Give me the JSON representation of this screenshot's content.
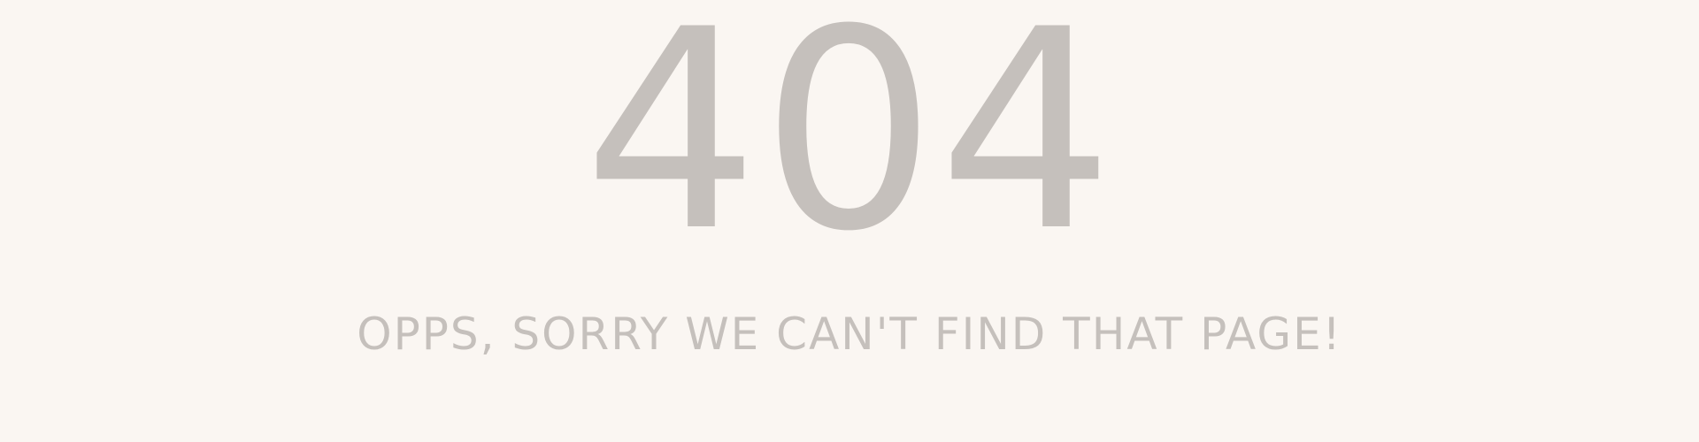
{
  "error": {
    "code": "404",
    "message": "OPPS, SORRY WE CAN'T FIND THAT PAGE!"
  },
  "colors": {
    "background": "#faf6f2",
    "text": "#c5c0bc"
  }
}
